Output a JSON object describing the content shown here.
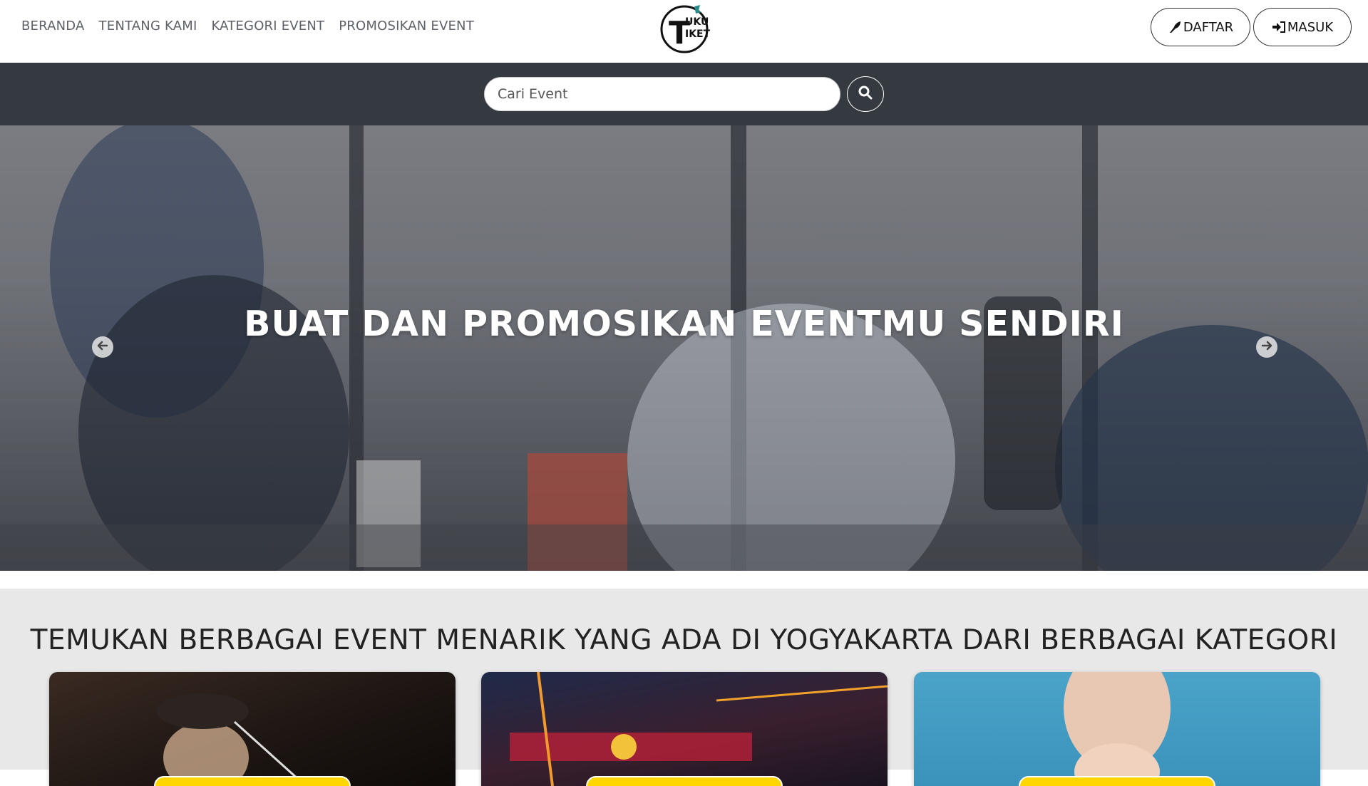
{
  "nav": {
    "links": [
      "BERANDA",
      "TENTANG KAMI",
      "KATEGORI EVENT",
      "PROMOSIKAN EVENT"
    ],
    "logo_text": [
      "T",
      "UKU",
      "IKET"
    ],
    "daftar_label": "DAFTAR",
    "masuk_label": "MASUK"
  },
  "search": {
    "placeholder": "Cari Event"
  },
  "hero": {
    "title": "BUAT DAN PROMOSIKAN EVENTMU SENDIRI"
  },
  "section": {
    "title": "TEMUKAN BERBAGAI EVENT MENARIK YANG ADA DI YOGYAKARTA DARI BERBAGAI KATEGORI"
  },
  "colors": {
    "search_bar_bg": "#343a40",
    "section_bg": "#e8e8e8",
    "badge": "#ffd600"
  }
}
